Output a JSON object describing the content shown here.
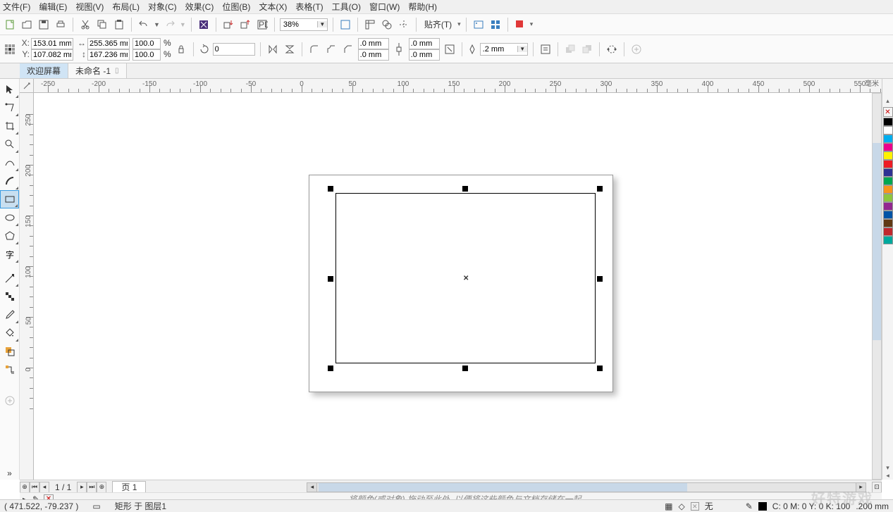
{
  "menu": [
    "文件(F)",
    "编辑(E)",
    "视图(V)",
    "布局(L)",
    "对象(C)",
    "效果(C)",
    "位图(B)",
    "文本(X)",
    "表格(T)",
    "工具(O)",
    "窗口(W)",
    "帮助(H)"
  ],
  "zoom_value": "38%",
  "snap_label": "贴齐(T)",
  "tabs": [
    {
      "label": "欢迎屏幕"
    },
    {
      "label": "未命名 -1"
    }
  ],
  "prop": {
    "x_label": "X:",
    "x_value": "153.01 mm",
    "y_label": "Y:",
    "y_value": "107.082 mm",
    "w_value": "255.365 mm",
    "h_value": "167.236 mm",
    "sx_value": "100.0",
    "sy_value": "100.0",
    "pct": "%",
    "angle_value": "0",
    "cr_a": ".0 mm",
    "cr_b": ".0 mm",
    "cr_c": ".0 mm",
    "cr_d": ".0 mm",
    "outline_value": ".2 mm"
  },
  "ruler_h": [
    "-250",
    "-200",
    "-150",
    "-100",
    "-50",
    "0",
    "50",
    "100",
    "150",
    "200",
    "250",
    "300",
    "350",
    "400",
    "450",
    "500",
    "550"
  ],
  "ruler_h_unit": "毫米",
  "ruler_v": [
    "250",
    "200",
    "150",
    "100",
    "50",
    "0"
  ],
  "page_nav": {
    "counter": "1 / 1",
    "page_label": "页 1"
  },
  "hint": "将颜色(或对象) 拖动至此处, 以便将这些颜色与文档存储在一起",
  "status": {
    "coords": "( 471.522, -79.237 )",
    "layer": "矩形 于 图层1",
    "fill_label": "无",
    "cmyk": "C: 0 M: 0 Y: 0 K: 100",
    "outline": ".200 mm"
  },
  "palette": [
    "#000",
    "#fff",
    "#00aeef",
    "#ec008c",
    "#fff200",
    "#ed1c24",
    "#2e3192",
    "#00a651",
    "#f7941d",
    "#8dc63e",
    "#92278f",
    "#0054a6",
    "#603913",
    "#c1272d",
    "#00a99d"
  ],
  "watermark": "好特游戏"
}
